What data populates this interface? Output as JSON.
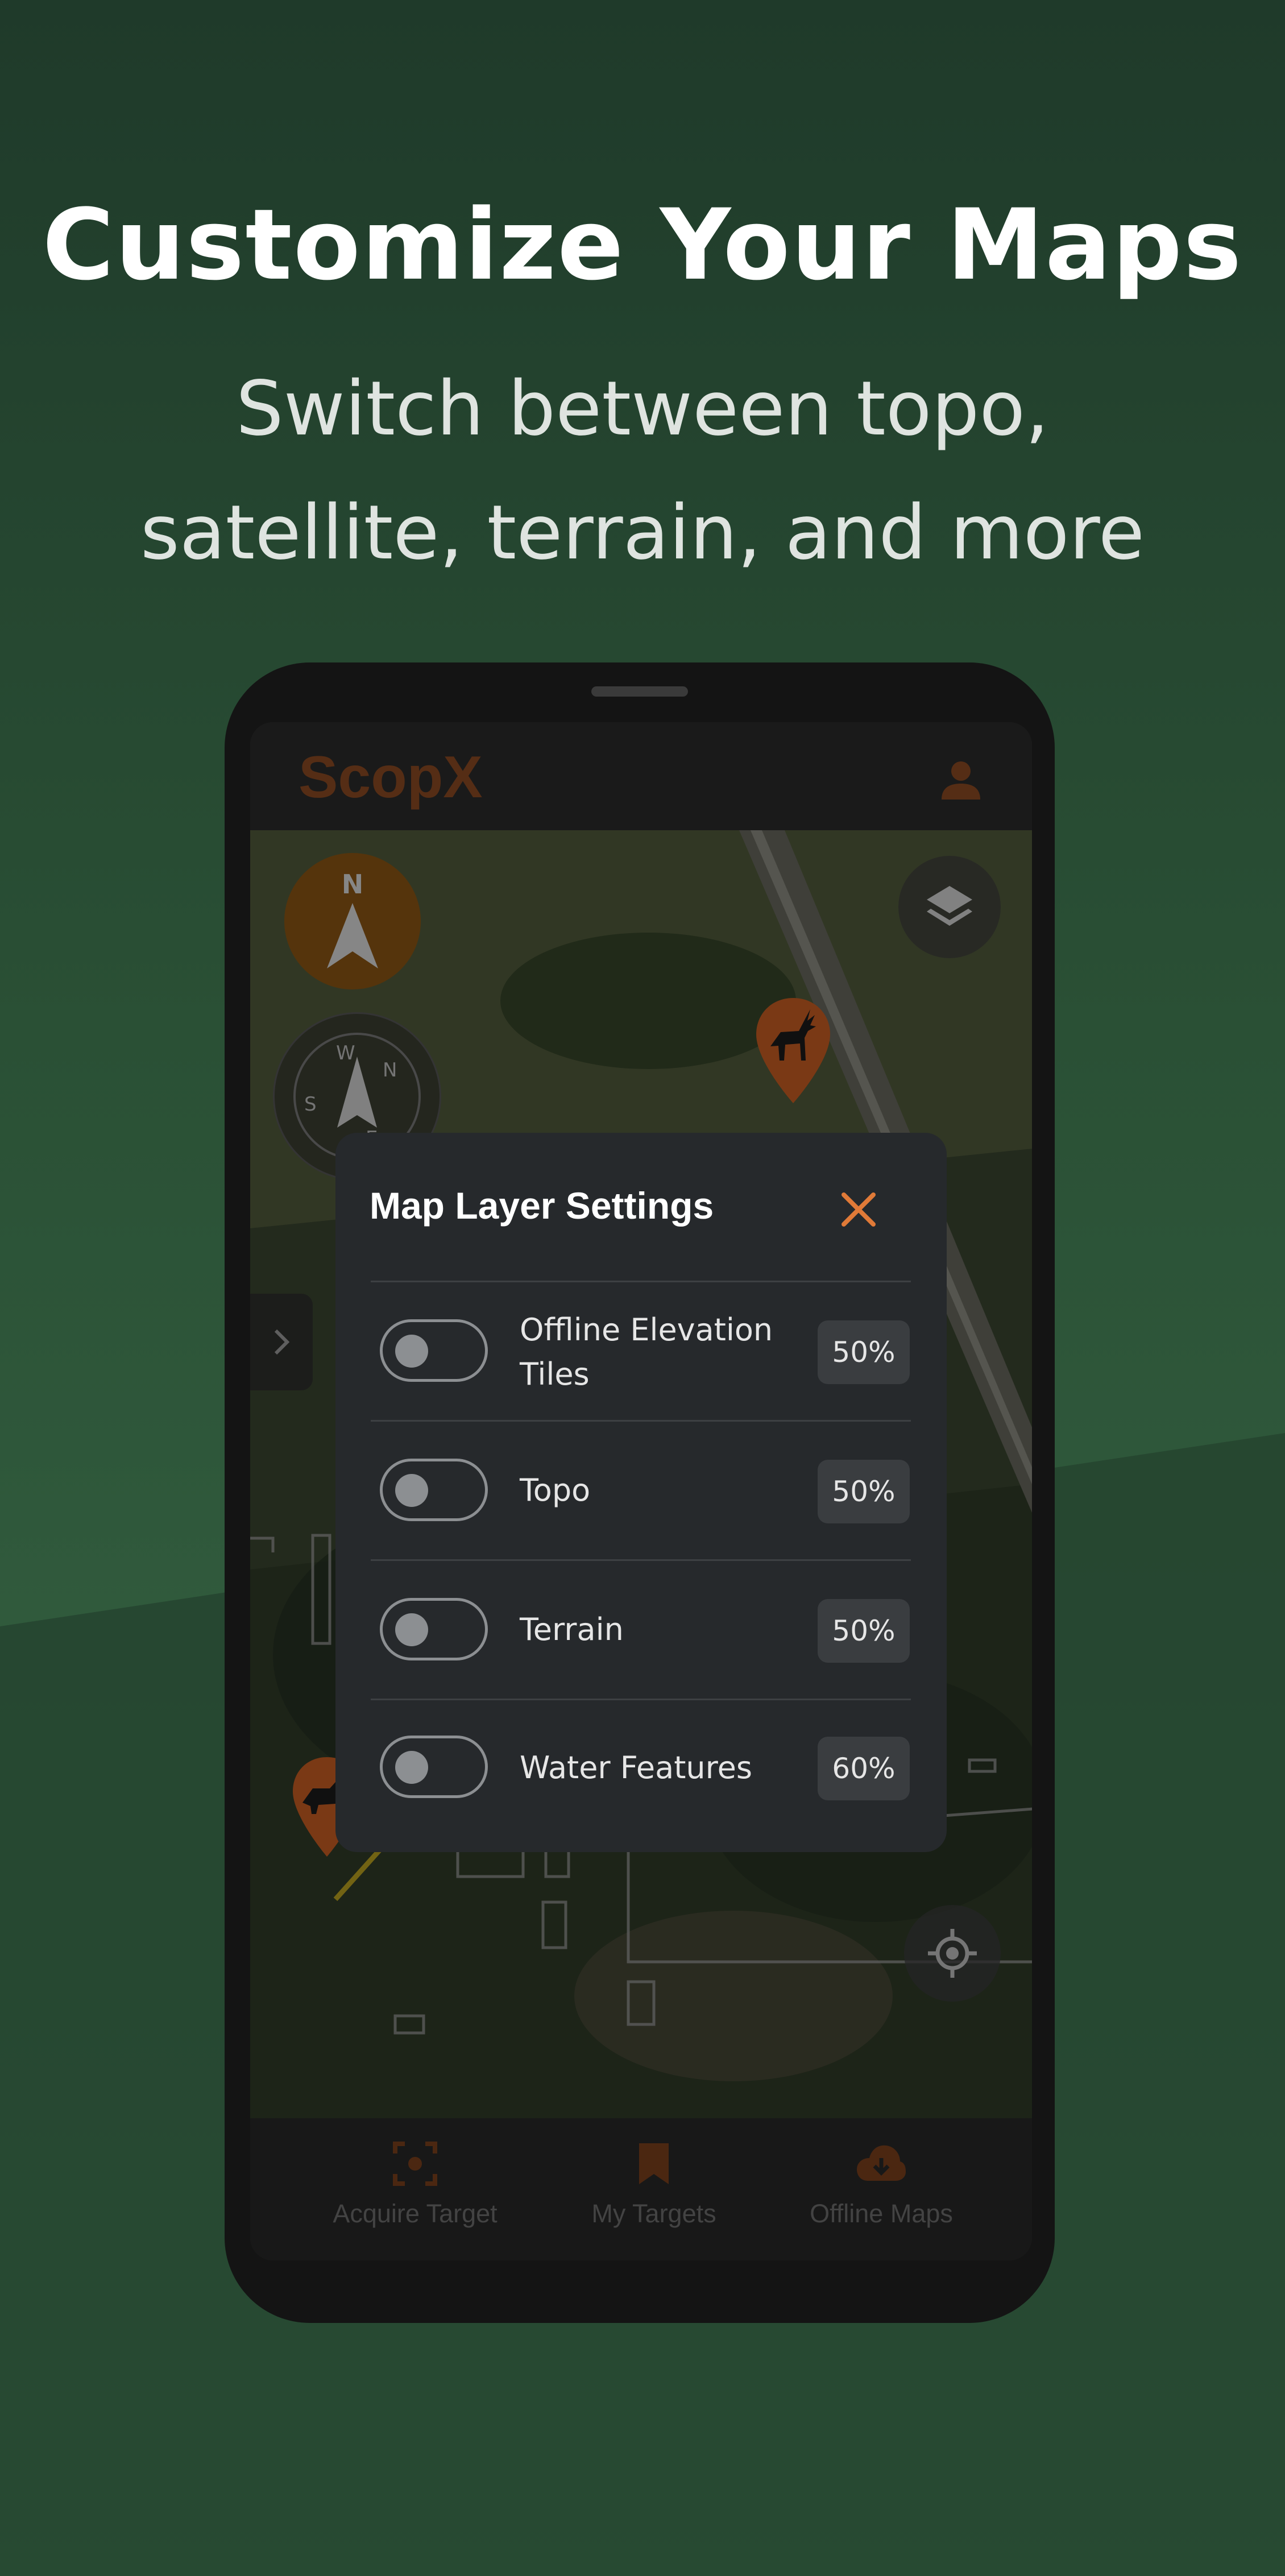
{
  "promo": {
    "headline": "Customize Your Maps",
    "subheadline": "Switch between topo, satellite, terrain, and more"
  },
  "app": {
    "brand": "ScopX",
    "compass_label": "N",
    "compass_rose_letters": [
      "W",
      "N",
      "E",
      "S"
    ]
  },
  "dialog": {
    "title": "Map Layer Settings",
    "layers": [
      {
        "label": "Offline Elevation Tiles",
        "opacity": "50%",
        "enabled": false
      },
      {
        "label": "Topo",
        "opacity": "50%",
        "enabled": false
      },
      {
        "label": "Terrain",
        "opacity": "50%",
        "enabled": false
      },
      {
        "label": "Water Features",
        "opacity": "60%",
        "enabled": false
      }
    ]
  },
  "bottom_nav": {
    "items": [
      {
        "label": "Acquire Target",
        "icon": "target-icon"
      },
      {
        "label": "My Targets",
        "icon": "bookmark-icon"
      },
      {
        "label": "Offline Maps",
        "icon": "cloud-download-icon"
      }
    ]
  },
  "colors": {
    "accent": "#e07a38",
    "brand_dim": "#8a4a22",
    "background_top": "#1f3a2a",
    "background_bottom": "#3a6a48"
  }
}
